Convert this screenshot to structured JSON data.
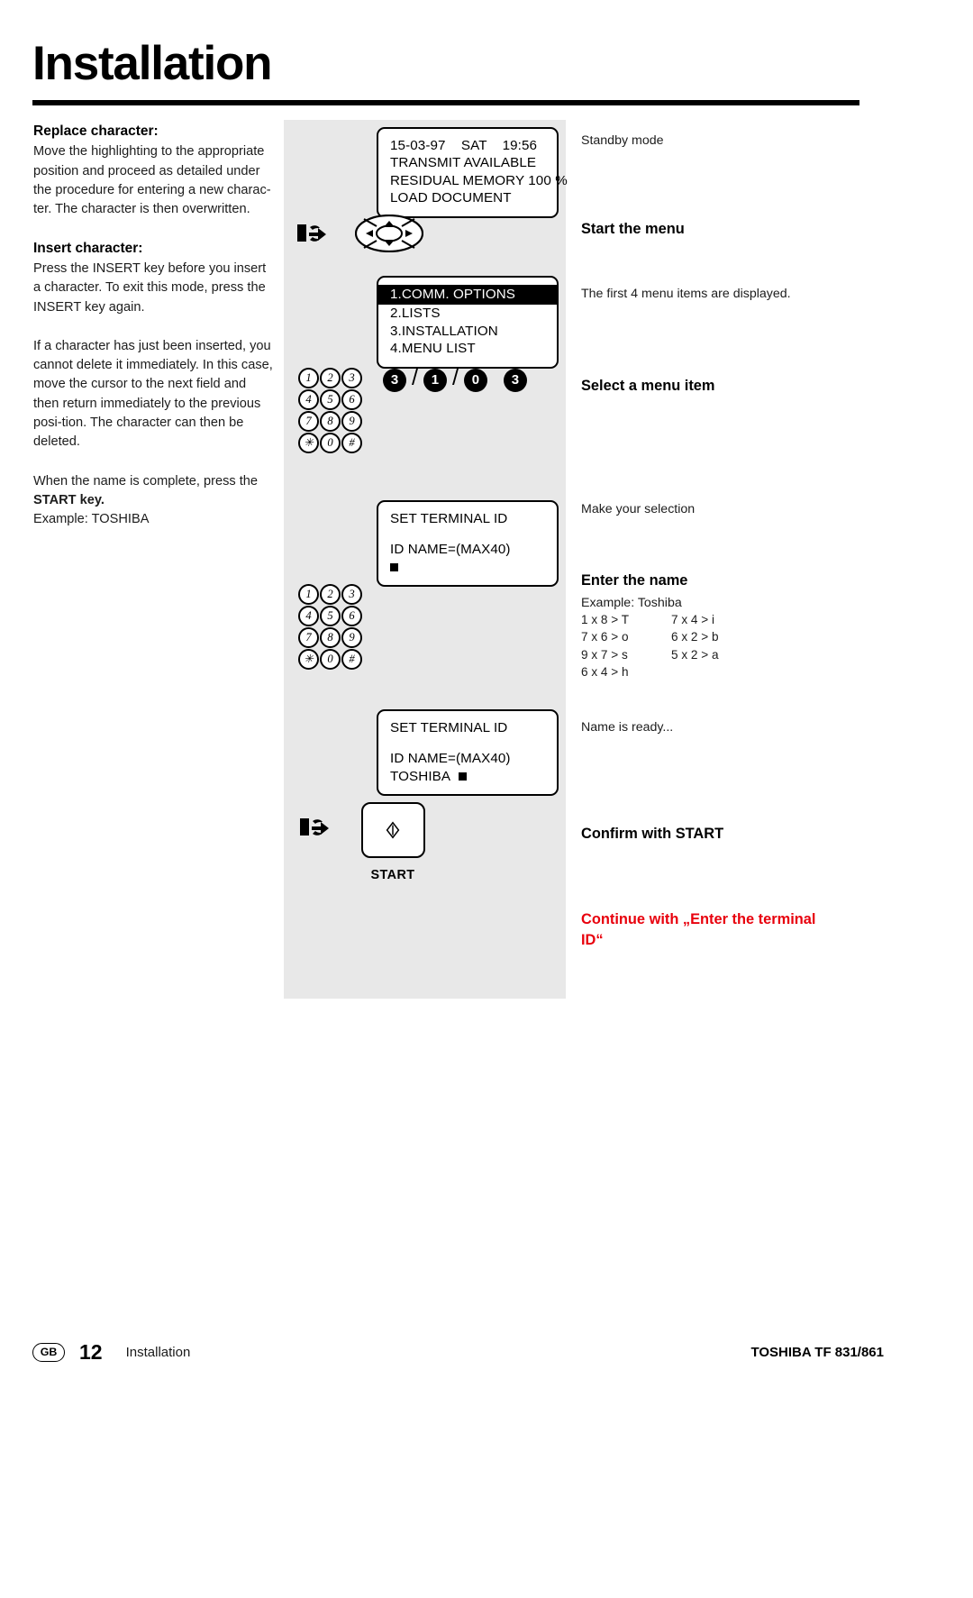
{
  "header": {
    "title": "Installation"
  },
  "left_column": {
    "replace": {
      "heading": "Replace character:",
      "body": "Move the highlighting to the appropriate position and proceed as detailed under the procedure for entering a new charac-ter. The character is then overwritten."
    },
    "insert": {
      "heading": "Insert character:",
      "body": "Press the INSERT key before you insert a character. To exit this mode, press the INSERT key again."
    },
    "note": "If a character has just been inserted, you cannot delete it immediately. In this case, move the cursor to the next field and then return immediately to the previous posi-tion. The character can then be deleted.",
    "final_1": "When the name is complete, press the",
    "final_2": "START key.",
    "final_3": "Example: TOSHIBA"
  },
  "displays": {
    "standby": {
      "line1": "15-03-97    SAT    19:56",
      "line2": "TRANSMIT AVAILABLE",
      "line3": "RESIDUAL MEMORY 100 %",
      "line4": "LOAD DOCUMENT"
    },
    "menu": {
      "line1": "1.COMM. OPTIONS",
      "line2": "2.LISTS",
      "line3": "3.INSTALLATION",
      "line4": "4.MENU LIST"
    },
    "set_terminal_id_empty": {
      "line1": "SET TERMINAL ID",
      "line2": "ID NAME=(MAX40)",
      "line3": ""
    },
    "set_terminal_id_filled": {
      "line1": "SET TERMINAL ID",
      "line2": "ID NAME=(MAX40)",
      "line3": "TOSHIBA"
    }
  },
  "keypad": {
    "rows": [
      [
        "1",
        "2",
        "3"
      ],
      [
        "4",
        "5",
        "6"
      ],
      [
        "7",
        "8",
        "9"
      ],
      [
        "✳",
        "0",
        "#"
      ]
    ]
  },
  "key_sequence": {
    "k1": "3",
    "sep1": "/",
    "k2": "1",
    "sep2": "/",
    "k3": "0",
    "k4": "3"
  },
  "start_button": {
    "label": "START",
    "icon": "start-diamond-icon"
  },
  "right_column": {
    "standby_mode": "Standby mode",
    "start_the_menu": "Start the menu",
    "first_four": "The first 4 menu items are displayed.",
    "select_menu_item": "Select a menu item",
    "make_selection": "Make your selection",
    "enter_the_name": "Enter the name",
    "example_label": "Example: Toshiba",
    "key_table": [
      {
        "a": "1 x 8 > T",
        "b": "7 x 4 > i"
      },
      {
        "a": "7 x 6 > o",
        "b": "6 x 2 > b"
      },
      {
        "a": "9 x 7 > s",
        "b": "5 x 2 > a"
      },
      {
        "a": "6 x 4 > h",
        "b": ""
      }
    ],
    "name_ready": "Name is ready...",
    "confirm_with_start": "Confirm with START",
    "continue_with": "Continue with „Enter the terminal ID“"
  },
  "footer": {
    "locale_badge": "GB",
    "page_number": "12",
    "section": "Installation",
    "product": "TOSHIBA  TF 831/861"
  },
  "colors": {
    "accent_red": "#e8000d",
    "panel_gray": "#e8e8e8",
    "ink": "#000000"
  }
}
